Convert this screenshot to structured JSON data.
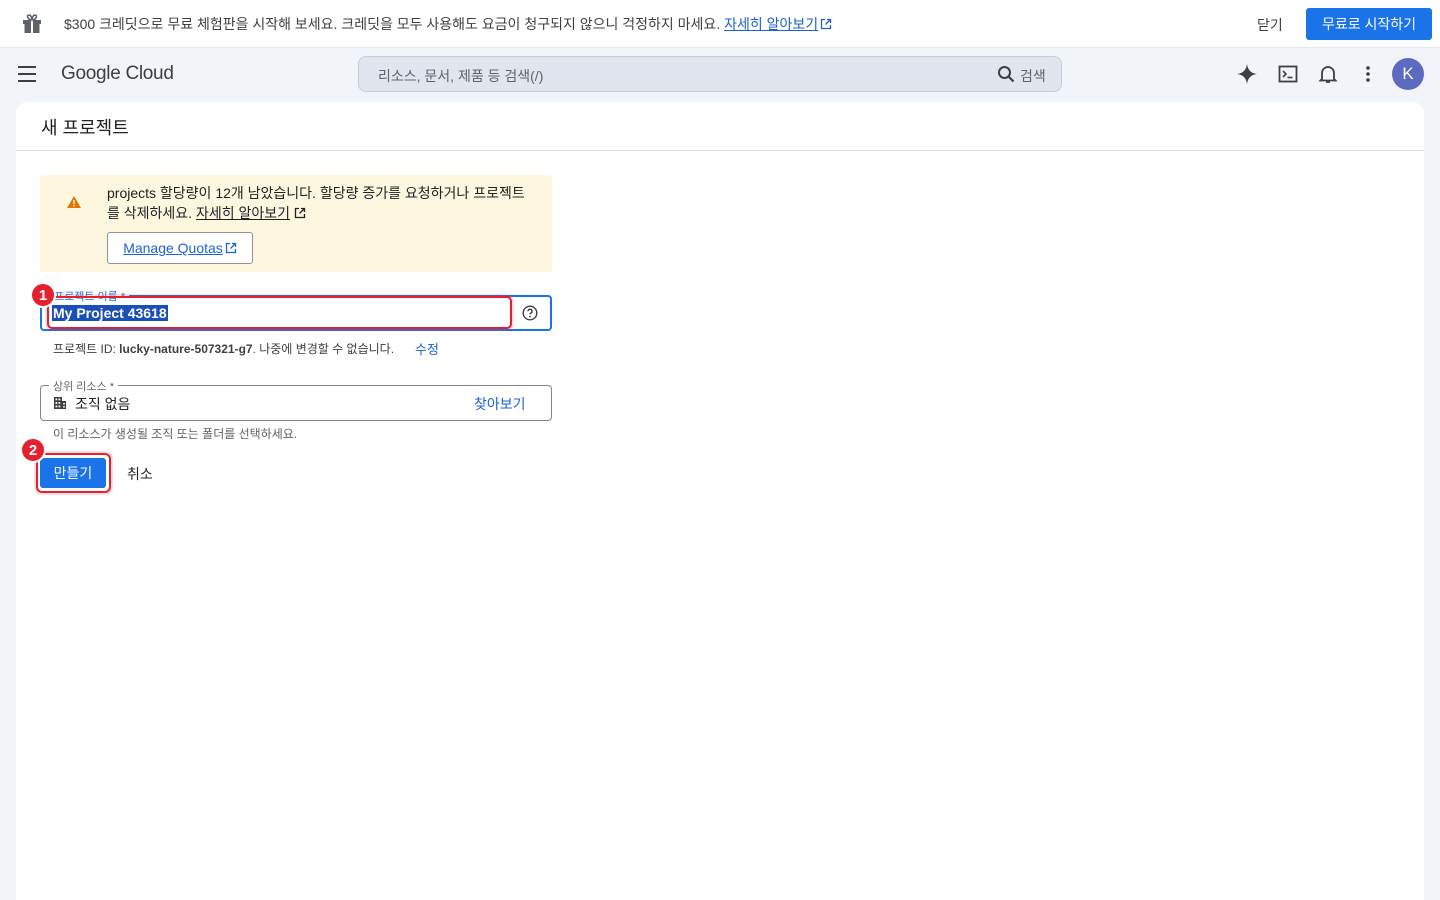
{
  "promo": {
    "text": "$300 크레딧으로 무료 체험판을 시작해 보세요. 크레딧을 모두 사용해도 요금이 청구되지 않으니 걱정하지 마세요.",
    "link": "자세히 알아보기",
    "close": "닫기",
    "start": "무료로 시작하기"
  },
  "header": {
    "logo": "Google Cloud",
    "search_placeholder": "리소스, 문서, 제품 등 검색(/)",
    "search_label": "검색",
    "avatar": "K"
  },
  "page": {
    "title": "새 프로젝트",
    "warning": {
      "text": "projects 할당량이 12개 남았습니다. 할당량 증가를 요청하거나 프로젝트를 삭제하세요.",
      "link": "자세히 알아보기",
      "button": "Manage Quotas"
    },
    "project_name": {
      "label": "프로젝트 이름 *",
      "value": "My Project 43618"
    },
    "project_id": {
      "prefix": "프로젝트 ID: ",
      "id": "lucky-nature-507321-g7",
      "suffix": ". 나중에 변경할 수 없습니다.",
      "edit": "수정"
    },
    "parent": {
      "label": "상위 리소스 *",
      "value": "조직 없음",
      "browse": "찾아보기",
      "hint": "이 리소스가 생성될 조직 또는 폴더를 선택하세요."
    },
    "create": "만들기",
    "cancel": "취소"
  },
  "annotations": [
    "1",
    "2"
  ]
}
